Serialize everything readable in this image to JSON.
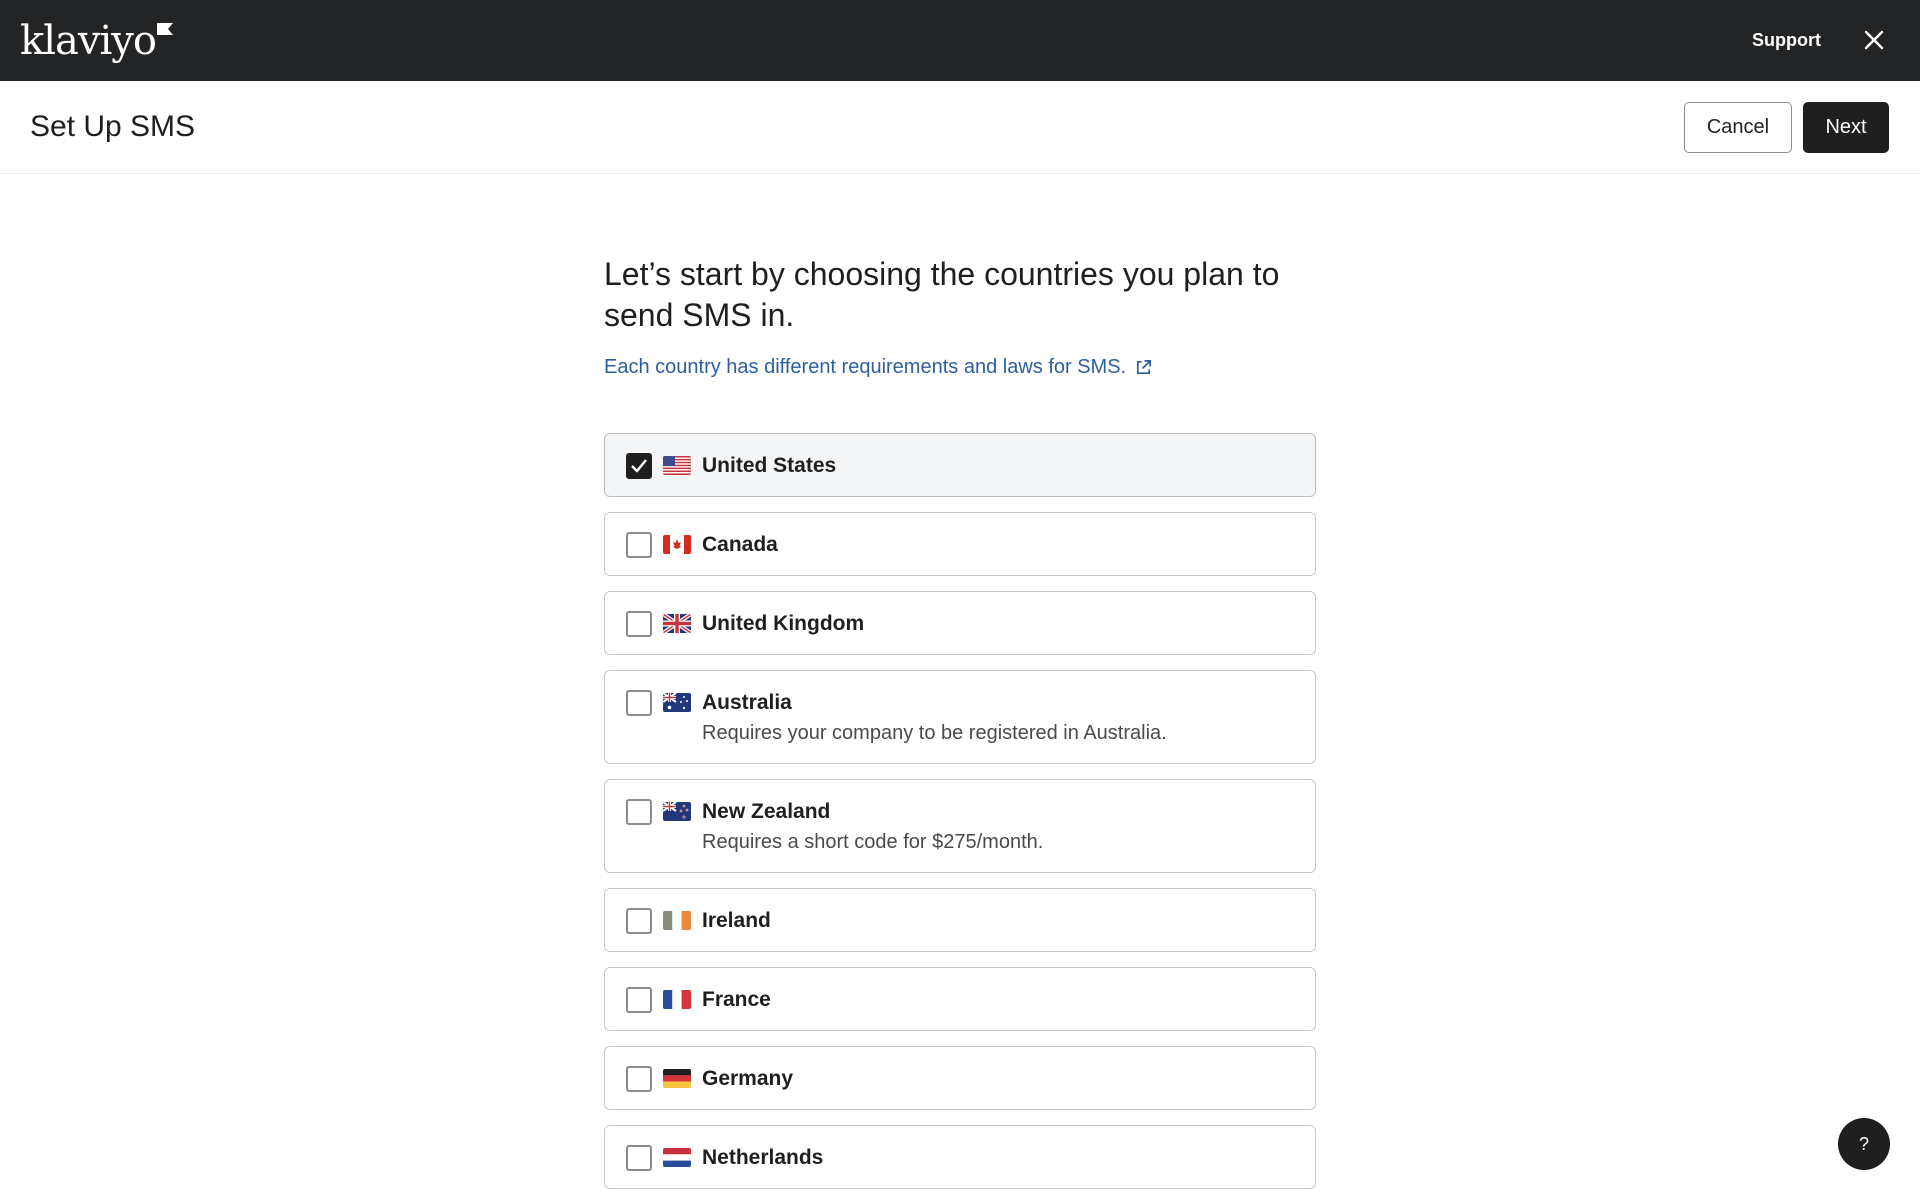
{
  "brand": {
    "logo_text": "klaviyo",
    "icon": "klaviyo-flag-logo"
  },
  "topbar": {
    "support_label": "Support",
    "close_icon": "close-icon"
  },
  "header": {
    "title": "Set Up SMS",
    "cancel_label": "Cancel",
    "next_label": "Next"
  },
  "main": {
    "heading": "Let’s start by choosing the countries you plan to send SMS in.",
    "info_link": "Each country has different requirements and laws for SMS.",
    "info_link_icon": "external-link-icon"
  },
  "countries": [
    {
      "name": "United States",
      "note": "",
      "checked": true,
      "flag": "us-flag"
    },
    {
      "name": "Canada",
      "note": "",
      "checked": false,
      "flag": "canada-flag"
    },
    {
      "name": "United Kingdom",
      "note": "",
      "checked": false,
      "flag": "uk-flag"
    },
    {
      "name": "Australia",
      "note": "Requires your company to be registered in Australia.",
      "checked": false,
      "flag": "australia-flag"
    },
    {
      "name": "New Zealand",
      "note": "Requires a short code for $275/month.",
      "checked": false,
      "flag": "new-zealand-flag"
    },
    {
      "name": "Ireland",
      "note": "",
      "checked": false,
      "flag": "ireland-flag"
    },
    {
      "name": "France",
      "note": "",
      "checked": false,
      "flag": "france-flag"
    },
    {
      "name": "Germany",
      "note": "",
      "checked": false,
      "flag": "germany-flag"
    },
    {
      "name": "Netherlands",
      "note": "",
      "checked": false,
      "flag": "netherlands-flag"
    }
  ],
  "help": {
    "label": "?",
    "icon": "help-icon"
  },
  "colors": {
    "topbar": "#232426",
    "primary": "#1f1f1f",
    "link": "#2c5f9e",
    "border": "#c9c9c9"
  }
}
